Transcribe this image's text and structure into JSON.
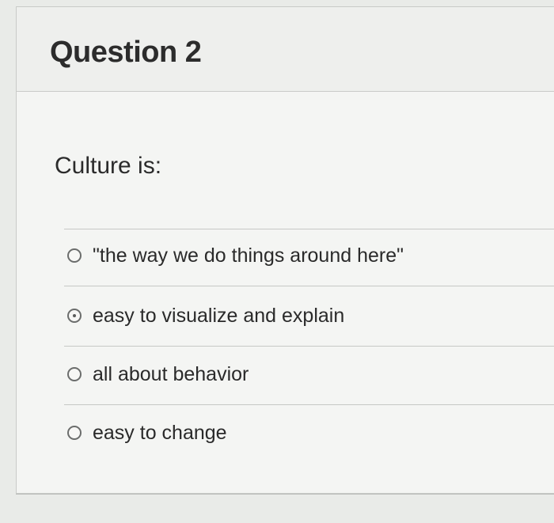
{
  "question": {
    "title": "Question 2",
    "prompt": "Culture is:",
    "options": [
      {
        "label": "\"the way we do things around here\"",
        "selected": false
      },
      {
        "label": "easy to visualize and explain",
        "selected": false
      },
      {
        "label": "all about behavior",
        "selected": false
      },
      {
        "label": "easy to change",
        "selected": false
      }
    ]
  }
}
